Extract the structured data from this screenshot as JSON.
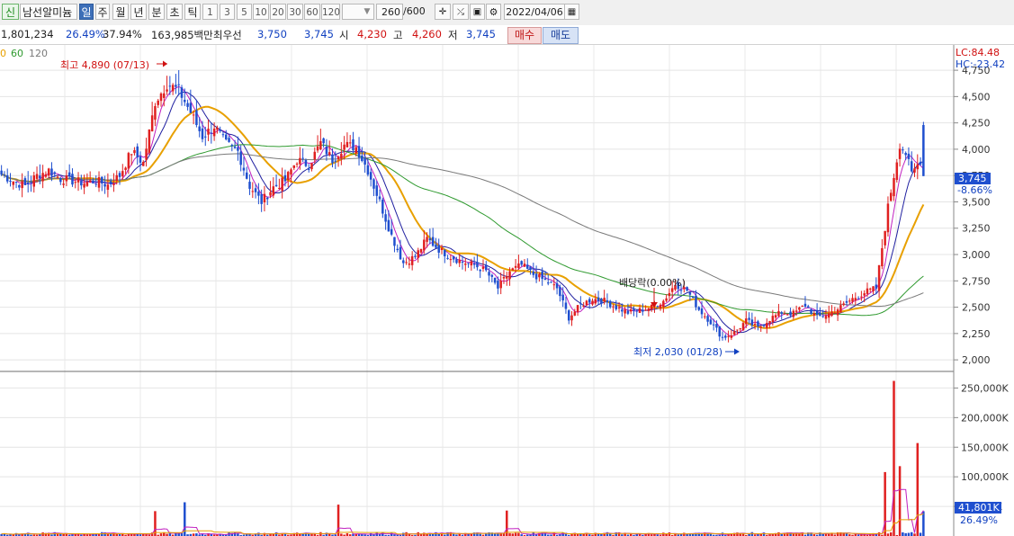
{
  "toolbar": {
    "badge": "신",
    "stock_name": "남선알미늄",
    "periods": [
      "일",
      "주",
      "월",
      "년",
      "분",
      "초",
      "틱"
    ],
    "active_period": "일",
    "intervals": [
      "1",
      "3",
      "5",
      "10",
      "20",
      "30",
      "60",
      "120"
    ],
    "bar_count": "260",
    "bar_max": "/600",
    "date": "2022/04/06"
  },
  "info": {
    "volume": "1,801,234",
    "turnover_rate": "26.49%",
    "ratio": "37.94%",
    "amount": "163,985백만",
    "best_bid_label": "최우선",
    "best_ask": "3,750",
    "best_bid": "3,745",
    "open_label": "시",
    "open": "4,230",
    "high_label": "고",
    "high": "4,260",
    "low_label": "저",
    "low": "3,745",
    "buy_label": "매수",
    "sell_label": "매도"
  },
  "ma_legend": [
    {
      "label": "0",
      "color": "#e8a000"
    },
    {
      "label": "60",
      "color": "#2f9a2f"
    },
    {
      "label": "120",
      "color": "#7a7a7a"
    }
  ],
  "colors": {
    "up": "#e02020",
    "down": "#1f4fcf",
    "ma5": "#c020c0",
    "ma10": "#2020a0",
    "ma20": "#e8a000",
    "ma60": "#2f9a2f",
    "ma120": "#7a7a7a"
  },
  "chart_data": {
    "type": "candlestick",
    "price_axis": {
      "ticks": [
        "4,750",
        "4,500",
        "4,250",
        "4,000",
        "3,750",
        "3,500",
        "3,250",
        "3,000",
        "2,750",
        "2,500",
        "2,250",
        "2,000"
      ],
      "tick_values": [
        4750,
        4500,
        4250,
        4000,
        3750,
        3500,
        3250,
        3000,
        2750,
        2500,
        2250,
        2000
      ],
      "ylim": [
        1890,
        4990
      ]
    },
    "volume_axis": {
      "ticks": [
        "250,000K",
        "200,000K",
        "150,000K",
        "100,000K",
        "50,000K"
      ],
      "tick_values": [
        250000,
        200000,
        150000,
        100000,
        50000
      ],
      "ylim": [
        0,
        278000
      ]
    },
    "current_price": "3,745",
    "current_value": 3745,
    "current_change": "-8.66%",
    "current_volume": "41,801K",
    "current_volume_rate": "26.49%",
    "lc_label": "LC:84.48",
    "hc_label": "HC:-23.42",
    "annotations": {
      "high_text": "최고 4,890 (07/13)",
      "high_value": 4890,
      "low_text": "최저 2,030 (01/28)",
      "low_value": 2030,
      "dividend_text": "배당락(0.00%)"
    },
    "price_keypoints": [
      [
        0,
        3760
      ],
      [
        4,
        3700
      ],
      [
        8,
        3650
      ],
      [
        12,
        3750
      ],
      [
        16,
        3800
      ],
      [
        20,
        3720
      ],
      [
        24,
        3700
      ],
      [
        28,
        3680
      ],
      [
        32,
        3700
      ],
      [
        36,
        3660
      ],
      [
        40,
        3750
      ],
      [
        44,
        3980
      ],
      [
        48,
        3870
      ],
      [
        52,
        4450
      ],
      [
        56,
        4620
      ],
      [
        60,
        4560
      ],
      [
        64,
        4350
      ],
      [
        68,
        4120
      ],
      [
        72,
        4220
      ],
      [
        76,
        4050
      ],
      [
        80,
        3980
      ],
      [
        84,
        3650
      ],
      [
        88,
        3500
      ],
      [
        92,
        3640
      ],
      [
        96,
        3700
      ],
      [
        100,
        3900
      ],
      [
        104,
        3850
      ],
      [
        108,
        4060
      ],
      [
        112,
        3900
      ],
      [
        116,
        4040
      ],
      [
        120,
        4020
      ],
      [
        124,
        3800
      ],
      [
        128,
        3500
      ],
      [
        132,
        3180
      ],
      [
        136,
        2920
      ],
      [
        140,
        2980
      ],
      [
        144,
        3150
      ],
      [
        148,
        3050
      ],
      [
        152,
        2980
      ],
      [
        156,
        2930
      ],
      [
        160,
        2900
      ],
      [
        164,
        2840
      ],
      [
        168,
        2680
      ],
      [
        172,
        2840
      ],
      [
        176,
        2900
      ],
      [
        180,
        2810
      ],
      [
        184,
        2750
      ],
      [
        188,
        2680
      ],
      [
        192,
        2400
      ],
      [
        196,
        2520
      ],
      [
        200,
        2580
      ],
      [
        204,
        2560
      ],
      [
        208,
        2500
      ],
      [
        212,
        2450
      ],
      [
        216,
        2470
      ],
      [
        220,
        2500
      ],
      [
        224,
        2560
      ],
      [
        228,
        2720
      ],
      [
        232,
        2660
      ],
      [
        236,
        2480
      ],
      [
        240,
        2360
      ],
      [
        244,
        2210
      ],
      [
        248,
        2260
      ],
      [
        252,
        2370
      ],
      [
        256,
        2300
      ],
      [
        260,
        2390
      ],
      [
        264,
        2450
      ],
      [
        268,
        2440
      ],
      [
        272,
        2520
      ],
      [
        276,
        2400
      ],
      [
        280,
        2440
      ],
      [
        284,
        2500
      ],
      [
        288,
        2580
      ],
      [
        292,
        2640
      ],
      [
        296,
        2680
      ],
      [
        300,
        3450
      ],
      [
        304,
        4050
      ],
      [
        306,
        3960
      ],
      [
        308,
        3760
      ],
      [
        311,
        3900
      ],
      [
        312,
        3745
      ]
    ],
    "volume_spikes": [
      [
        52,
        42000
      ],
      [
        62,
        57000
      ],
      [
        114,
        53000
      ],
      [
        171,
        43000
      ],
      [
        299,
        108000
      ],
      [
        302,
        262000
      ],
      [
        304,
        118000
      ],
      [
        310,
        157000
      ],
      [
        312,
        41801
      ]
    ]
  }
}
